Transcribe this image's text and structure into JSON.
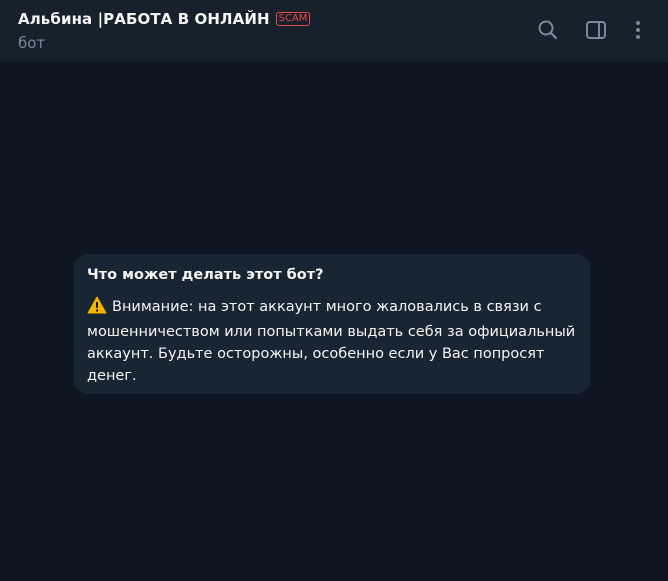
{
  "header": {
    "title": "Альбина |РАБОТА В ОНЛАЙН",
    "badge": "SCAM",
    "subtitle": "бот",
    "icons": [
      "search-icon",
      "sidebar-panel-icon",
      "more-vertical-icon"
    ]
  },
  "bot_info": {
    "title": "Что может делать этот бот?",
    "warning_icon": "warning-icon",
    "text": "Внимание: на этот аккаунт много жаловались в связи с мошенничеством или попытками выдать себя за официальный аккаунт. Будьте осторожны, особенно если у Вас попросят денег."
  },
  "colors": {
    "background": "#0e1621",
    "header": "#17212b",
    "card": "#182533",
    "scam": "#e5484d",
    "muted_text": "#7c8a98"
  }
}
